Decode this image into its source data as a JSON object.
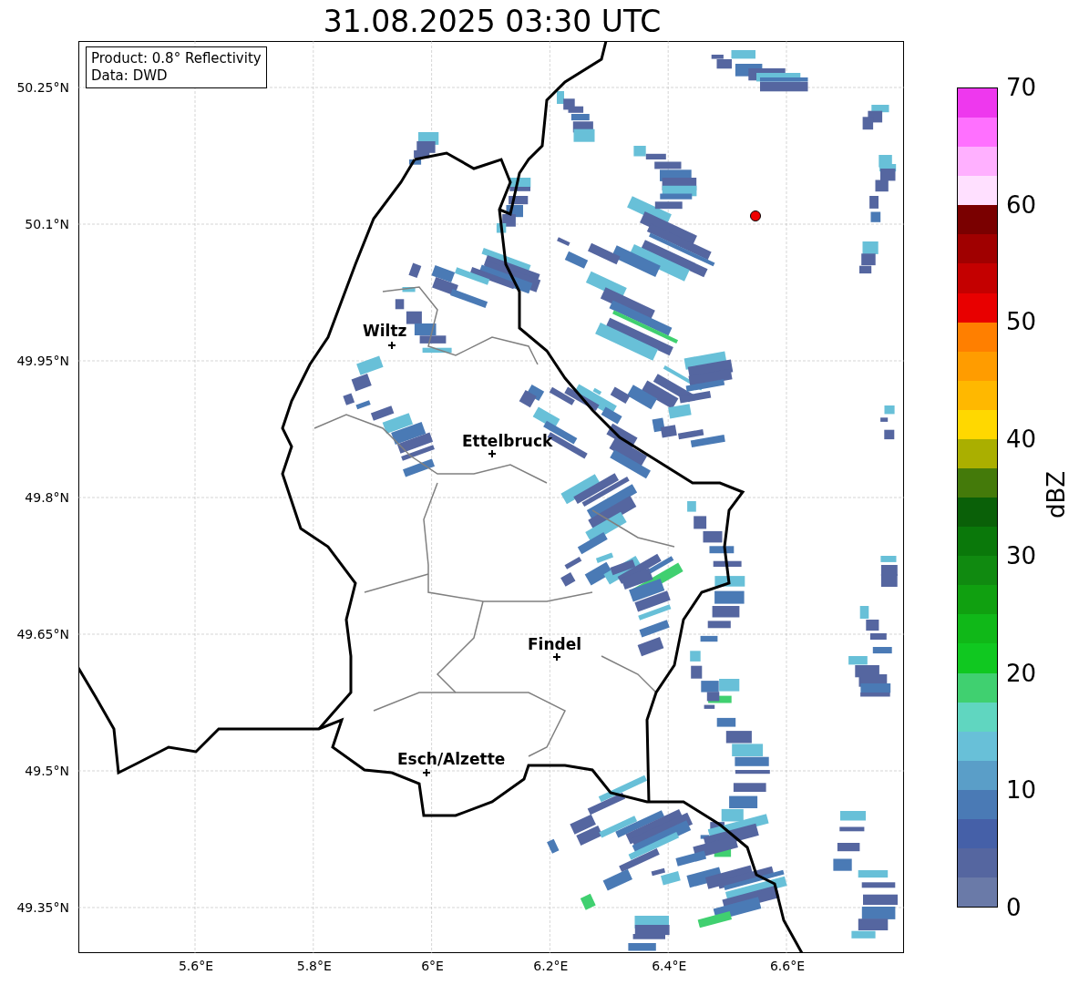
{
  "title": "31.08.2025 03:30 UTC",
  "map": {
    "legend": [
      "Product: 0.8° Reflectivity",
      "Data: DWD"
    ],
    "places": [
      {
        "name": "Wiltz"
      },
      {
        "name": "Ettelbruck"
      },
      {
        "name": "Findel"
      },
      {
        "name": "Esch/Alzette"
      }
    ],
    "xticks": [
      "5.6°E",
      "5.8°E",
      "6°E",
      "6.2°E",
      "6.4°E",
      "6.6°E"
    ],
    "yticks": [
      "50.25°N",
      "50.1°N",
      "49.95°N",
      "49.8°N",
      "49.65°N",
      "49.5°N",
      "49.35°N"
    ]
  },
  "colorbar": {
    "label": "dBZ",
    "ticks": [
      "70",
      "60",
      "50",
      "40",
      "30",
      "20",
      "10",
      "0"
    ],
    "bins": [
      {
        "color": "#ee38ee"
      },
      {
        "color": "#ff70ff"
      },
      {
        "color": "#ffb0ff"
      },
      {
        "color": "#ffe0ff"
      },
      {
        "color": "#7a0000"
      },
      {
        "color": "#a00000"
      },
      {
        "color": "#c40000"
      },
      {
        "color": "#e80000"
      },
      {
        "color": "#ff7f00"
      },
      {
        "color": "#ff9c00"
      },
      {
        "color": "#ffb800"
      },
      {
        "color": "#ffd800"
      },
      {
        "color": "#aaaf00"
      },
      {
        "color": "#447a0a"
      },
      {
        "color": "#0a6008"
      },
      {
        "color": "#0a780a"
      },
      {
        "color": "#108a10"
      },
      {
        "color": "#10a010"
      },
      {
        "color": "#10b818"
      },
      {
        "color": "#10c820"
      },
      {
        "color": "#40d070"
      },
      {
        "color": "#60d6c0"
      },
      {
        "color": "#68c0d8"
      },
      {
        "color": "#5a9ec8"
      },
      {
        "color": "#4a7ab5"
      },
      {
        "color": "#4560a8"
      },
      {
        "color": "#5566a0"
      },
      {
        "color": "#6a7aa8"
      }
    ]
  }
}
